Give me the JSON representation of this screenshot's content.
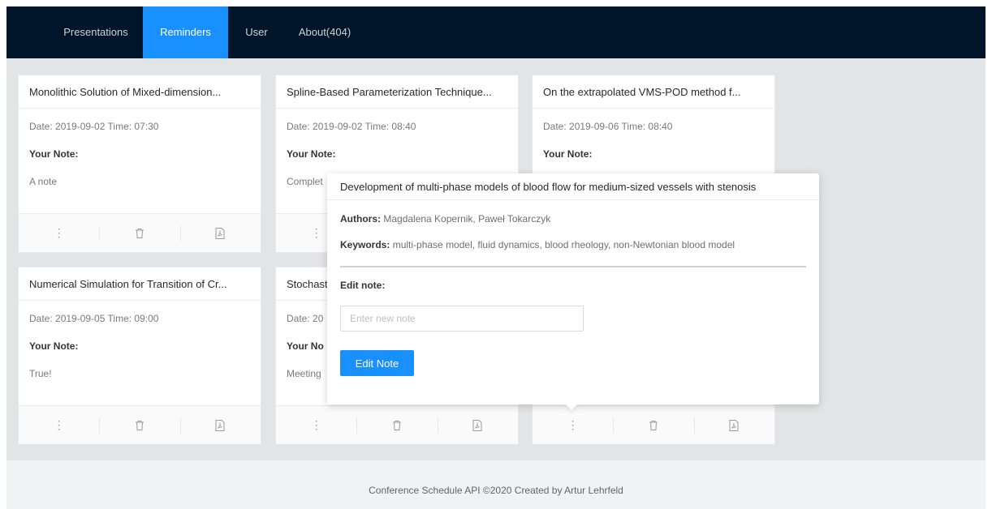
{
  "nav": {
    "items": [
      {
        "label": "Presentations",
        "active": false
      },
      {
        "label": "Reminders",
        "active": true
      },
      {
        "label": "User",
        "active": false
      },
      {
        "label": "About(404)",
        "active": false
      }
    ]
  },
  "cards": [
    {
      "title": "Monolithic Solution of Mixed-dimension...",
      "datetime": "Date: 2019-09-02 Time: 07:30",
      "note_label": "Your Note:",
      "note": "A note"
    },
    {
      "title": "Spline-Based Parameterization Technique...",
      "datetime": "Date: 2019-09-02 Time: 08:40",
      "note_label": "Your Note:",
      "note": "Complet"
    },
    {
      "title": "On the extrapolated VMS-POD method f...",
      "datetime": "Date: 2019-09-06 Time: 08:40",
      "note_label": "Your Note:",
      "note": ""
    },
    {
      "title": "Numerical Simulation for Transition of Cr...",
      "datetime": "Date: 2019-09-05 Time: 09:00",
      "note_label": "Your Note:",
      "note": "True!"
    },
    {
      "title": "Stochast",
      "datetime": "Date: 20",
      "note_label": "Your No",
      "note": "Meeting"
    },
    {
      "title": "",
      "datetime": "",
      "note_label": "",
      "note": ""
    }
  ],
  "card_actions": {
    "more_icon": "⋮",
    "delete_icon": "trash-icon",
    "pdf_icon": "pdf-icon"
  },
  "popover": {
    "title": "Development of multi-phase models of blood flow for medium-sized vessels with stenosis",
    "authors_label": "Authors:",
    "authors": "Magdalena Kopernik, Paweł Tokarczyk",
    "keywords_label": "Keywords:",
    "keywords": "multi-phase model, fluid dynamics, blood rheology, non-Newtonian blood model",
    "edit_label": "Edit note:",
    "input_value": "",
    "input_placeholder": "Enter new note",
    "button_label": "Edit Note"
  },
  "footer": {
    "text": "Conference Schedule API ©2020 Created by Artur Lehrfeld"
  },
  "colors": {
    "header_bg": "#001529",
    "accent": "#1890ff",
    "content_bg": "#e3e4e6",
    "footer_bg": "#f0f2f5"
  }
}
